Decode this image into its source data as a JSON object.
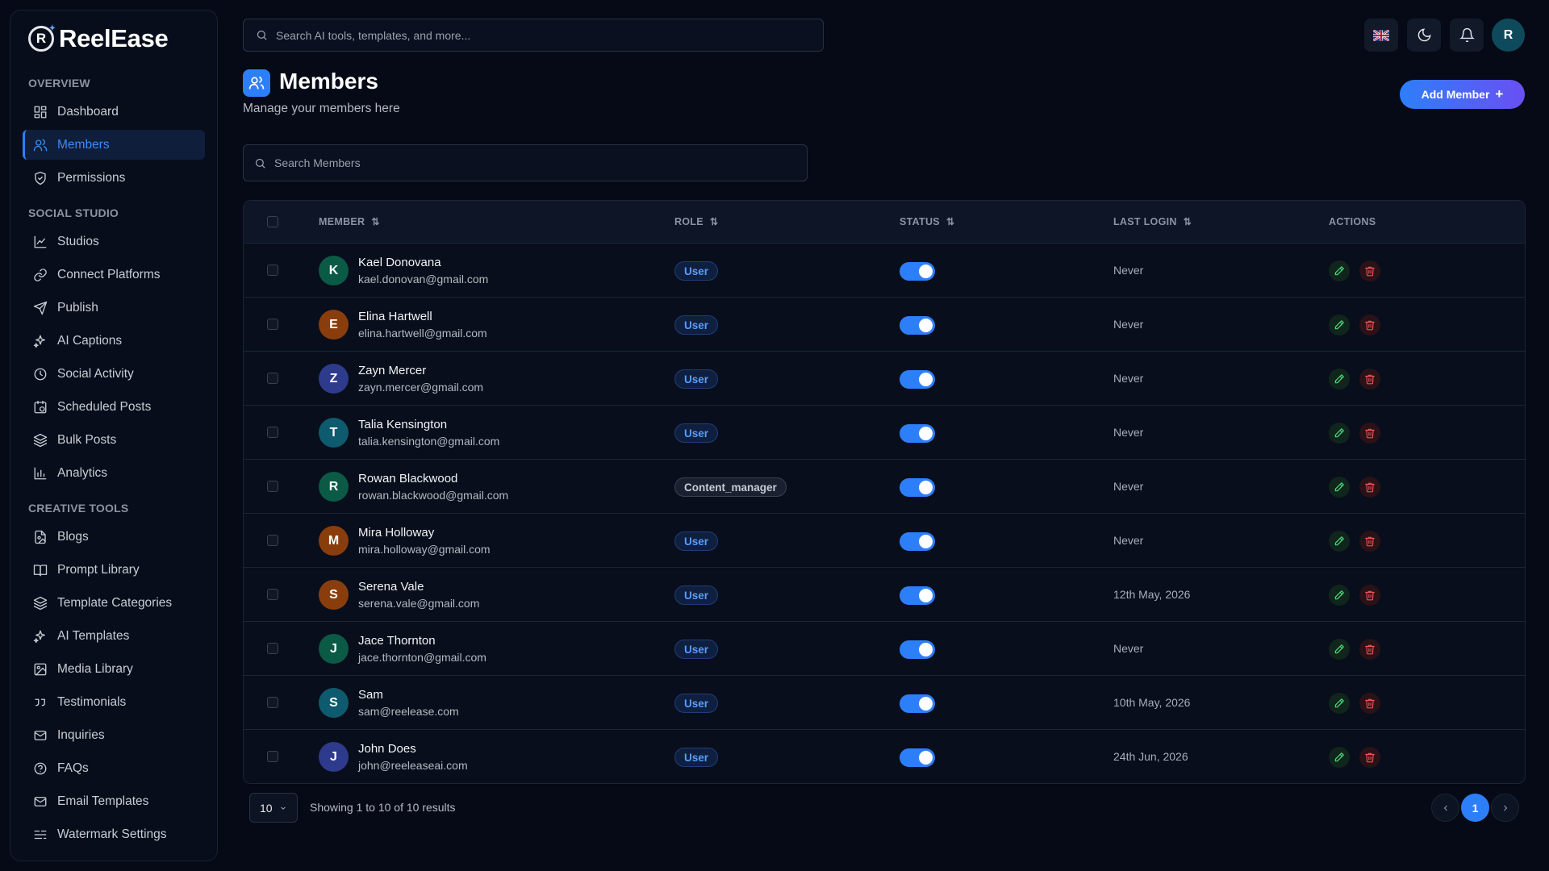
{
  "app": {
    "name": "ReelEase",
    "logo_letter": "R"
  },
  "sidebar": {
    "sections": [
      {
        "title": "OVERVIEW",
        "items": [
          {
            "label": "Dashboard",
            "icon": "dashboard-icon",
            "active": false
          },
          {
            "label": "Members",
            "icon": "users-icon",
            "active": true
          },
          {
            "label": "Permissions",
            "icon": "shield-icon",
            "active": false
          }
        ]
      },
      {
        "title": "SOCIAL STUDIO",
        "items": [
          {
            "label": "Studios",
            "icon": "chart-icon",
            "active": false
          },
          {
            "label": "Connect Platforms",
            "icon": "link-icon",
            "active": false
          },
          {
            "label": "Publish",
            "icon": "send-icon",
            "active": false
          },
          {
            "label": "AI Captions",
            "icon": "sparkles-icon",
            "active": false
          },
          {
            "label": "Social Activity",
            "icon": "clock-icon",
            "active": false
          },
          {
            "label": "Scheduled Posts",
            "icon": "calendar-clock-icon",
            "active": false
          },
          {
            "label": "Bulk Posts",
            "icon": "layers-icon",
            "active": false
          },
          {
            "label": "Analytics",
            "icon": "bar-chart-icon",
            "active": false
          }
        ]
      },
      {
        "title": "CREATIVE TOOLS",
        "items": [
          {
            "label": "Blogs",
            "icon": "file-image-icon",
            "active": false
          },
          {
            "label": "Prompt Library",
            "icon": "book-icon",
            "active": false
          },
          {
            "label": "Template Categories",
            "icon": "layers-icon",
            "active": false
          },
          {
            "label": "AI Templates",
            "icon": "sparkles-icon",
            "active": false
          },
          {
            "label": "Media Library",
            "icon": "image-icon",
            "active": false
          },
          {
            "label": "Testimonials",
            "icon": "quote-icon",
            "active": false
          },
          {
            "label": "Inquiries",
            "icon": "mail-icon",
            "active": false
          },
          {
            "label": "FAQs",
            "icon": "help-circle-icon",
            "active": false
          },
          {
            "label": "Email Templates",
            "icon": "mail-icon",
            "active": false
          },
          {
            "label": "Watermark Settings",
            "icon": "sliders-icon",
            "active": false
          }
        ]
      }
    ]
  },
  "topbar": {
    "search_placeholder": "Search AI tools, templates, and more...",
    "user_initial": "R"
  },
  "header": {
    "title": "Members",
    "subtitle": "Manage your members here",
    "add_button": "Add Member"
  },
  "member_search": {
    "placeholder": "Search Members"
  },
  "table": {
    "columns": [
      "MEMBER",
      "ROLE",
      "STATUS",
      "LAST LOGIN",
      "ACTIONS"
    ],
    "rows": [
      {
        "initial": "K",
        "name": "Kael Donovana",
        "email": "kael.donovan@gmail.com",
        "role": "User",
        "status_on": true,
        "last_login": "Never",
        "avatar_color": "#0b5a45"
      },
      {
        "initial": "E",
        "name": "Elina Hartwell",
        "email": "elina.hartwell@gmail.com",
        "role": "User",
        "status_on": true,
        "last_login": "Never",
        "avatar_color": "#8a3d0c"
      },
      {
        "initial": "Z",
        "name": "Zayn Mercer",
        "email": "zayn.mercer@gmail.com",
        "role": "User",
        "status_on": true,
        "last_login": "Never",
        "avatar_color": "#2e3a8c"
      },
      {
        "initial": "T",
        "name": "Talia Kensington",
        "email": "talia.kensington@gmail.com",
        "role": "User",
        "status_on": true,
        "last_login": "Never",
        "avatar_color": "#0e5a6e"
      },
      {
        "initial": "R",
        "name": "Rowan Blackwood",
        "email": "rowan.blackwood@gmail.com",
        "role": "Content_manager",
        "status_on": true,
        "last_login": "Never",
        "avatar_color": "#0b5a45"
      },
      {
        "initial": "M",
        "name": "Mira Holloway",
        "email": "mira.holloway@gmail.com",
        "role": "User",
        "status_on": true,
        "last_login": "Never",
        "avatar_color": "#8a3d0c"
      },
      {
        "initial": "S",
        "name": "Serena Vale",
        "email": "serena.vale@gmail.com",
        "role": "User",
        "status_on": true,
        "last_login": "12th May, 2026",
        "avatar_color": "#8a3d0c"
      },
      {
        "initial": "J",
        "name": "Jace Thornton",
        "email": "jace.thornton@gmail.com",
        "role": "User",
        "status_on": true,
        "last_login": "Never",
        "avatar_color": "#0b5a45"
      },
      {
        "initial": "S",
        "name": "Sam",
        "email": "sam@reelease.com",
        "role": "User",
        "status_on": true,
        "last_login": "10th May, 2026",
        "avatar_color": "#0e5a6e"
      },
      {
        "initial": "J",
        "name": "John Does",
        "email": "john@reeleaseai.com",
        "role": "User",
        "status_on": true,
        "last_login": "24th Jun, 2026",
        "avatar_color": "#2e3a8c"
      }
    ]
  },
  "pagination": {
    "page_size": "10",
    "summary": "Showing 1 to 10 of 10 results",
    "current_page": "1"
  },
  "colors": {
    "accent": "#2d7ff9",
    "background": "#050a16"
  }
}
